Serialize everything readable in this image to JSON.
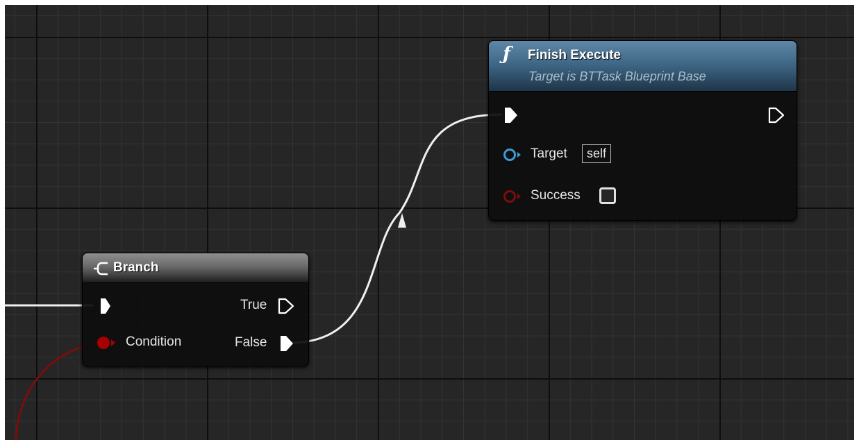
{
  "graph": {
    "branch_node": {
      "title": "Branch",
      "header_icon": "branch-arrow-icon",
      "inputs": {
        "condition_label": "Condition"
      },
      "outputs": {
        "true_label": "True",
        "false_label": "False"
      }
    },
    "finish_execute_node": {
      "title": "Finish Execute",
      "subtitle": "Target is BTTask Blueprint Base",
      "header_icon": "function-f-icon",
      "inputs": {
        "target_label": "Target",
        "target_default": "self",
        "success_label": "Success",
        "success_checked": false
      }
    }
  },
  "colors": {
    "canvas_background": "#262626",
    "grid_minor": "#333333",
    "grid_major": "#0e0e0e",
    "exec_wire": "#f0f0f0",
    "bool_pin": "#a80000",
    "object_pin": "#3d9bd6",
    "function_header": "#3d6482",
    "branch_header": "#6a6a6a"
  }
}
